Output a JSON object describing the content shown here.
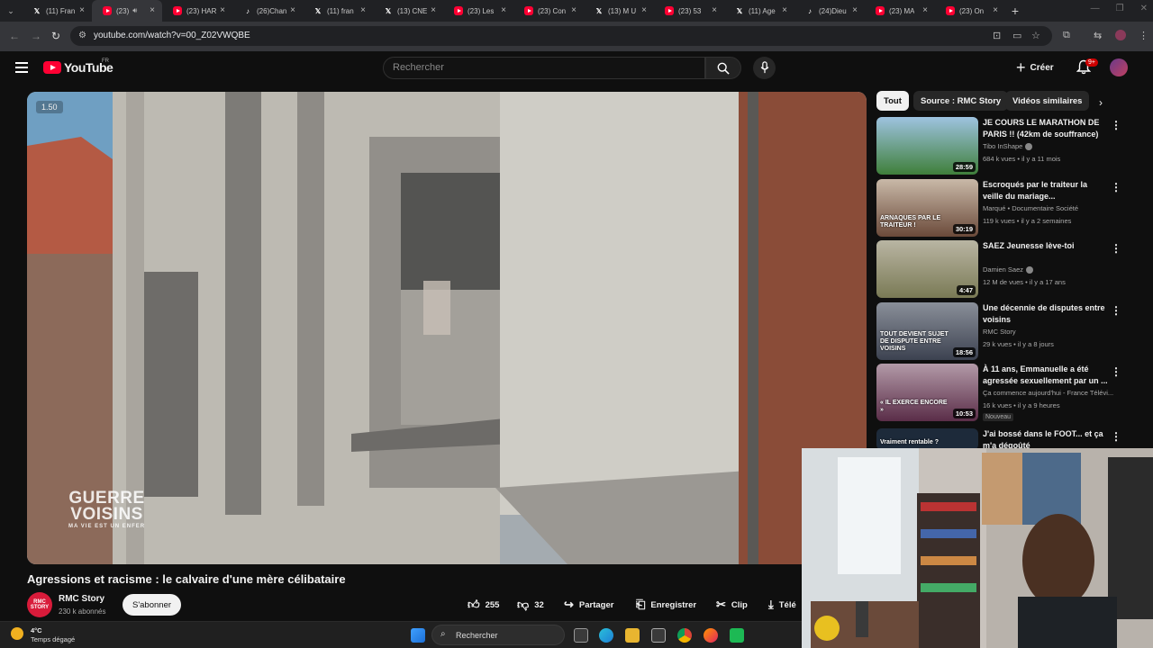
{
  "browser": {
    "tabs": [
      {
        "icon": "x-icon",
        "label": "(11) Fran"
      },
      {
        "icon": "youtube-icon",
        "label": "(23)",
        "active": true,
        "audio": true
      },
      {
        "icon": "youtube-icon",
        "label": "(23) HAR"
      },
      {
        "icon": "tiktok-icon",
        "label": "(26)Chan"
      },
      {
        "icon": "x-icon",
        "label": "(11) fran"
      },
      {
        "icon": "x-icon",
        "label": "(13) CNE"
      },
      {
        "icon": "youtube-icon",
        "label": "(23) Les"
      },
      {
        "icon": "youtube-icon",
        "label": "(23) Con"
      },
      {
        "icon": "x-icon",
        "label": "(13) M U"
      },
      {
        "icon": "youtube-icon",
        "label": "(23) 53"
      },
      {
        "icon": "x-icon",
        "label": "(11) Age"
      },
      {
        "icon": "tiktok-icon",
        "label": "(24)Dieu"
      },
      {
        "icon": "youtube-icon",
        "label": "(23) MA"
      },
      {
        "icon": "youtube-icon",
        "label": "(23) On"
      }
    ],
    "url": "youtube.com/watch?v=00_Z02VWQBE"
  },
  "youtube": {
    "logo_text": "YouTube",
    "region": "FR",
    "search_placeholder": "Rechercher",
    "create_label": "Créer",
    "notif_count": "9+"
  },
  "player": {
    "speed": "1.50",
    "show_logo_line1": "GUERRE",
    "show_logo_line2": "VOISINS",
    "show_logo_sub": "MA VIE EST UN ENFER"
  },
  "chips": [
    "Tout",
    "Source : RMC Story",
    "Vidéos similaires"
  ],
  "recommendations": [
    {
      "title": "JE COURS LE MARATHON DE PARIS !! (42km de souffrance)",
      "channel": "Tibo InShape",
      "verified": true,
      "meta": "684 k vues • il y a 11 mois",
      "duration": "28:59",
      "thumb_top": "#9ec3e0",
      "thumb_bottom": "#3f7f3a"
    },
    {
      "title": "Escroqués par le traiteur la veille du mariage...",
      "channel": "Marqué • Documentaire Société",
      "verified": false,
      "meta": "119 k vues • il y a 2 semaines",
      "duration": "30:19",
      "thumb_overlay": "ARNAQUES PAR LE TRAITEUR !",
      "thumb_top": "#c9b9a8",
      "thumb_bottom": "#6b4a3a"
    },
    {
      "title": "SAEZ  Jeunesse lève-toi",
      "channel": "Damien Saez",
      "verified": true,
      "meta": "12 M de vues • il y a 17 ans",
      "duration": "4:47",
      "thumb_top": "#b9b5a3",
      "thumb_bottom": "#7a7a55"
    },
    {
      "title": "Une décennie de disputes entre voisins",
      "channel": "RMC Story",
      "verified": false,
      "meta": "29 k vues • il y a 8 jours",
      "duration": "18:56",
      "thumb_overlay": "TOUT DEVIENT SUJET DE DISPUTE ENTRE VOISINS",
      "thumb_top": "#8a8f99",
      "thumb_bottom": "#3c4250"
    },
    {
      "title": "À 11 ans, Emmanuelle a été agressée sexuellement par un ...",
      "channel": "Ça commence aujourd'hui - France Télévi...",
      "verified": false,
      "meta": "16 k vues • il y a 9 heures",
      "duration": "10:53",
      "badge": "Nouveau",
      "thumb_overlay": "« IL EXERCE ENCORE »",
      "thumb_top": "#b39aa8",
      "thumb_bottom": "#5a2d48"
    },
    {
      "title": "J'ai bossé dans le FOOT... et ça m'a dégoûté",
      "channel": "",
      "verified": false,
      "meta": "",
      "duration": "",
      "thumb_overlay": "Vraiment rentable ?",
      "thumb_top": "#1d2a3a",
      "thumb_bottom": "#1d2a3a"
    }
  ],
  "video": {
    "title": "Agressions et racisme : le calvaire d'une mère célibataire",
    "channel": "RMC Story",
    "channel_avatar_text": "RMC STORY",
    "subscribers": "230 k abonnés",
    "subscribe_label": "S'abonner",
    "likes": "255",
    "dislikes": "32",
    "share_label": "Partager",
    "save_label": "Enregistrer",
    "clip_label": "Clip",
    "download_label": "Télé"
  },
  "taskbar": {
    "temperature": "4°C",
    "weather": "Temps dégagé",
    "search_label": "Rechercher"
  },
  "colors": {
    "accent": "#ff0033",
    "background": "#0f0f0f",
    "chip_active": "#f1f1f1"
  }
}
